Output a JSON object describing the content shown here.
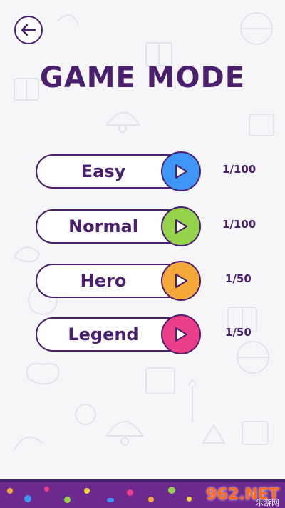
{
  "screen": {
    "title": "GAME MODE"
  },
  "modes": [
    {
      "label": "Easy",
      "progress": "1/100",
      "color": "#3f96f5"
    },
    {
      "label": "Normal",
      "progress": "1/100",
      "color": "#93d24a"
    },
    {
      "label": "Hero",
      "progress": "1/50",
      "color": "#f4a83a"
    },
    {
      "label": "Legend",
      "progress": "1/50",
      "color": "#ec3f8a"
    }
  ],
  "icons": {
    "back": "arrow-left-icon",
    "play": "play-icon"
  },
  "watermark": {
    "main": "962.NET",
    "sub": "乐游网"
  },
  "colors": {
    "primary": "#4a1f6d",
    "footer": "#6d2a8e",
    "background": "#f6f6f8"
  }
}
